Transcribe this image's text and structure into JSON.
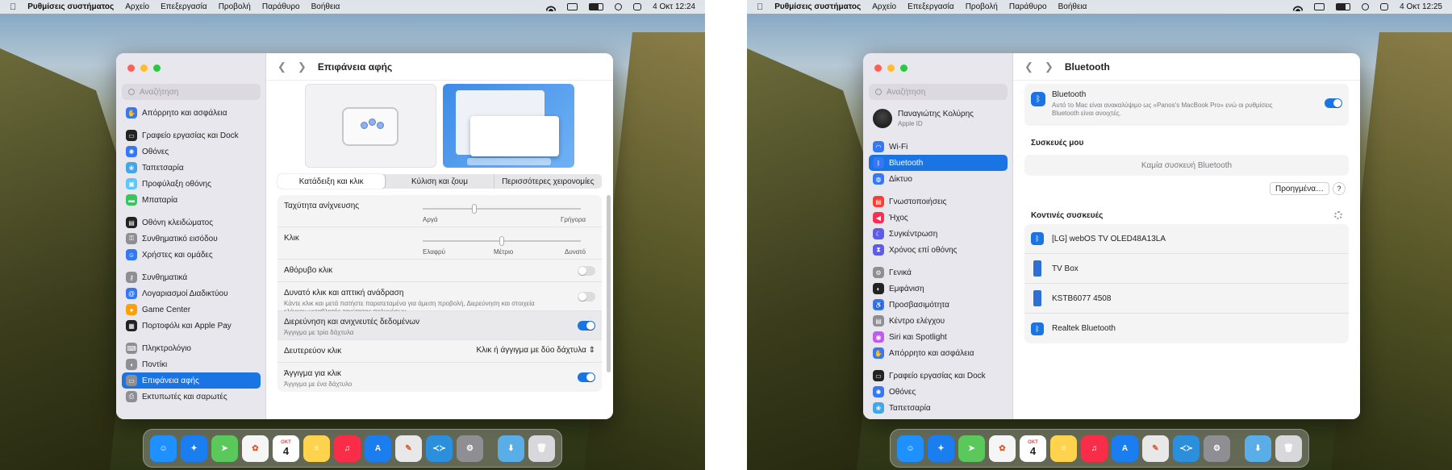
{
  "left": {
    "menubar": {
      "app_name": "Ρυθμίσεις συστήματος",
      "items": [
        "Αρχείο",
        "Επεξεργασία",
        "Προβολή",
        "Παράθυρο",
        "Βοήθεια"
      ],
      "clock": "4 Οκτ 12:24"
    },
    "sidebar": {
      "search_placeholder": "Αναζήτηση",
      "items": [
        {
          "label": "Απόρρητο και ασφάλεια",
          "color": "#3478f6",
          "glyph": "✋"
        },
        {
          "label": "Γραφείο εργασίας και Dock",
          "color": "#222222",
          "glyph": "▭"
        },
        {
          "label": "Οθόνες",
          "color": "#3478f6",
          "glyph": "✺"
        },
        {
          "label": "Ταπετσαρία",
          "color": "#41a7e8",
          "glyph": "❀"
        },
        {
          "label": "Προφύλαξη οθόνης",
          "color": "#5ac8fa",
          "glyph": "▣"
        },
        {
          "label": "Μπαταρία",
          "color": "#34c759",
          "glyph": "▬"
        },
        {
          "label": "Οθόνη κλειδώματος",
          "color": "#222222",
          "glyph": "▤"
        },
        {
          "label": "Συνθηματικό εισόδου",
          "color": "#8e8e93",
          "glyph": "⚿"
        },
        {
          "label": "Χρήστες και ομάδες",
          "color": "#3478f6",
          "glyph": "☺"
        },
        {
          "label": "Συνθηματικά",
          "color": "#8e8e93",
          "glyph": "⚷"
        },
        {
          "label": "Λογαριασμοί Διαδικτύου",
          "color": "#3478f6",
          "glyph": "@"
        },
        {
          "label": "Game Center",
          "color": "#ff9f0a",
          "glyph": "●"
        },
        {
          "label": "Πορτοφόλι και Apple Pay",
          "color": "#222222",
          "glyph": "▦"
        },
        {
          "label": "Πληκτρολόγιο",
          "color": "#8e8e93",
          "glyph": "⌨"
        },
        {
          "label": "Ποντίκι",
          "color": "#8e8e93",
          "glyph": "◖"
        },
        {
          "label": "Επιφάνεια αφής",
          "color": "#8e8e93",
          "glyph": "▭"
        },
        {
          "label": "Εκτυπωτές και σαρωτές",
          "color": "#8e8e93",
          "glyph": "⎙"
        }
      ]
    },
    "page_title": "Επιφάνεια αφής",
    "tabs": [
      "Κατάδειξη και κλικ",
      "Κύλιση και ζουμ",
      "Περισσότερες χειρονομίες"
    ],
    "settings": {
      "tracking_label": "Ταχύτητα ανίχνευσης",
      "tracking_min": "Αργά",
      "tracking_max": "Γρήγορα",
      "tracking_value": 0.32,
      "click_label": "Κλικ",
      "click_min": "Ελαφρύ",
      "click_mid": "Μέτριο",
      "click_max": "Δυνατό",
      "click_value": 0.5,
      "silent_label": "Αθόρυβο κλικ",
      "silent_on": false,
      "force_label": "Δυνατό κλικ και απτική ανάδραση",
      "force_sub": "Κάντε κλικ και μετά πατήστε παρατεταμένα για άμεση προβολή, Διερεύνηση και στοιχεία ελέγχου μεταβλητής ταχύτητας πολυμέσων.",
      "force_on": false,
      "lookup_label": "Διερεύνηση και ανιχνευτές δεδομένων",
      "lookup_sub": "Άγγιγμα με τρία δάχτυλα",
      "lookup_on": true,
      "secondary_label": "Δευτερεύον κλικ",
      "secondary_value": "Κλικ ή άγγιγμα με δύο δάχτυλα",
      "tap_label": "Άγγιγμα για κλικ",
      "tap_sub": "Άγγιγμα με ένα δάχτυλο",
      "tap_on": true
    }
  },
  "right": {
    "menubar": {
      "app_name": "Ρυθμίσεις συστήματος",
      "items": [
        "Αρχείο",
        "Επεξεργασία",
        "Προβολή",
        "Παράθυρο",
        "Βοήθεια"
      ],
      "clock": "4 Οκτ 12:25"
    },
    "sidebar": {
      "search_placeholder": "Αναζήτηση",
      "profile_name": "Παναγιώτης Κολύρης",
      "profile_sub": "Apple ID",
      "items": [
        {
          "label": "Wi-Fi",
          "color": "#3478f6",
          "glyph": "◠"
        },
        {
          "label": "Bluetooth",
          "color": "#3478f6",
          "glyph": "ᛒ"
        },
        {
          "label": "Δίκτυο",
          "color": "#3478f6",
          "glyph": "◍"
        },
        {
          "label": "Γνωστοποιήσεις",
          "color": "#ff3b30",
          "glyph": "▤"
        },
        {
          "label": "Ήχος",
          "color": "#ff2d55",
          "glyph": "◀"
        },
        {
          "label": "Συγκέντρωση",
          "color": "#5e5ce6",
          "glyph": "☾"
        },
        {
          "label": "Χρόνος επί οθόνης",
          "color": "#5e5ce6",
          "glyph": "⧗"
        },
        {
          "label": "Γενικά",
          "color": "#8e8e93",
          "glyph": "⚙"
        },
        {
          "label": "Εμφάνιση",
          "color": "#222222",
          "glyph": "◐"
        },
        {
          "label": "Προσβασιμότητα",
          "color": "#3478f6",
          "glyph": "♿"
        },
        {
          "label": "Κέντρο ελέγχου",
          "color": "#8e8e93",
          "glyph": "▤"
        },
        {
          "label": "Siri και Spotlight",
          "color": "#bf5af2",
          "glyph": "◉"
        },
        {
          "label": "Απόρρητο και ασφάλεια",
          "color": "#3478f6",
          "glyph": "✋"
        },
        {
          "label": "Γραφείο εργασίας και Dock",
          "color": "#222222",
          "glyph": "▭"
        },
        {
          "label": "Οθόνες",
          "color": "#3478f6",
          "glyph": "✺"
        },
        {
          "label": "Ταπετσαρία",
          "color": "#41a7e8",
          "glyph": "❀"
        }
      ]
    },
    "page_title": "Bluetooth",
    "bluetooth": {
      "title": "Bluetooth",
      "desc": "Αυτό το Mac είναι ανακαλύψιμο ως «Panos's MacBook Pro» ενώ οι ρυθμίσεις Bluetooth είναι ανοιχτές.",
      "on": true
    },
    "my_devices_title": "Συσκευές μου",
    "no_devices": "Καμία συσκευή Bluetooth",
    "advanced_label": "Προηγμένα…",
    "help_label": "?",
    "nearby_title": "Κοντινές συσκευές",
    "nearby": [
      {
        "name": "[LG] webOS TV OLED48A13LA",
        "kind": "bt"
      },
      {
        "name": "TV Box",
        "kind": "phone"
      },
      {
        "name": "KSTB6077 4508",
        "kind": "phone"
      },
      {
        "name": "Realtek Bluetooth",
        "kind": "bt"
      }
    ]
  },
  "dock": {
    "apps": [
      {
        "name": "finder",
        "color": "#1e90ff",
        "glyph": "☺"
      },
      {
        "name": "safari",
        "color": "#1a7ef0",
        "glyph": "✦"
      },
      {
        "name": "maps",
        "color": "#5ac85a",
        "glyph": "➤"
      },
      {
        "name": "photos",
        "color": "#f5f5f5",
        "glyph": "✿"
      },
      {
        "name": "calendar",
        "color": "#ffffff",
        "glyph": "4"
      },
      {
        "name": "notes",
        "color": "#ffd34d",
        "glyph": "≡"
      },
      {
        "name": "music",
        "color": "#fa2d48",
        "glyph": "♫"
      },
      {
        "name": "app-store",
        "color": "#1a7ef0",
        "glyph": "A"
      },
      {
        "name": "pixelmator",
        "color": "#e8e8e8",
        "glyph": "✎"
      },
      {
        "name": "vscode",
        "color": "#2b8fdc",
        "glyph": "≺≻"
      },
      {
        "name": "system-settings",
        "color": "#8e8e93",
        "glyph": "⚙"
      }
    ],
    "calendar_month": "ΟΚΤ",
    "trailing": [
      {
        "name": "downloads",
        "color": "#5aaee8",
        "glyph": "⬇"
      },
      {
        "name": "trash",
        "color": "#d8d8dc",
        "glyph": "🗑"
      }
    ]
  }
}
